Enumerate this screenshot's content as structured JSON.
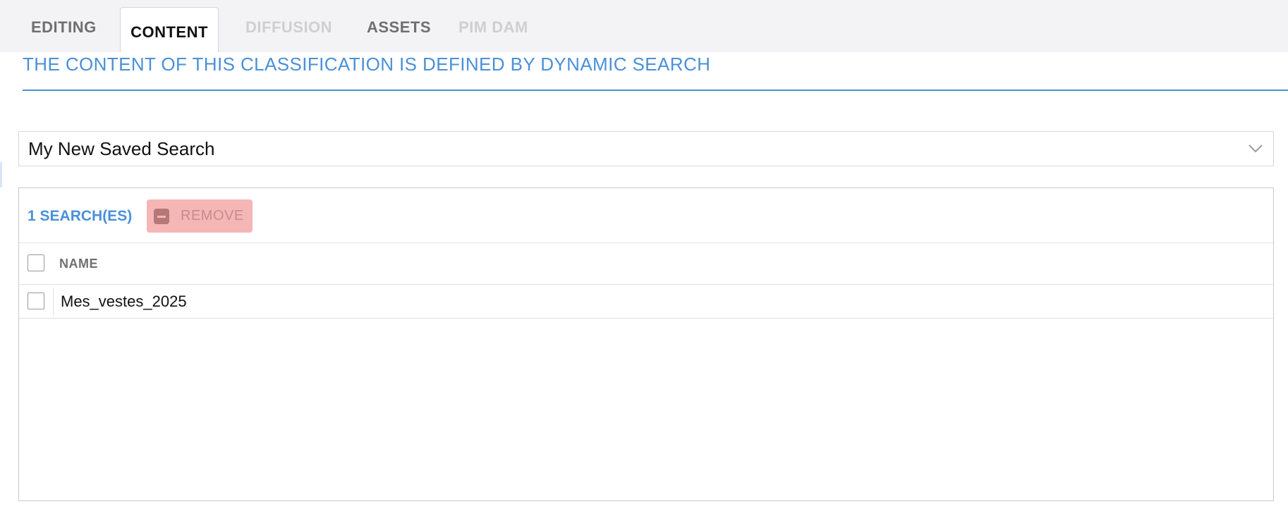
{
  "tabs": [
    {
      "label": "EDITING",
      "state": "normal"
    },
    {
      "label": "CONTENT",
      "state": "active"
    },
    {
      "label": "DIFFUSION",
      "state": "disabled"
    },
    {
      "label": "ASSETS",
      "state": "normal"
    },
    {
      "label": "PIM DAM",
      "state": "disabled"
    }
  ],
  "section": {
    "title": "THE CONTENT OF THIS CLASSIFICATION IS DEFINED BY DYNAMIC SEARCH"
  },
  "search_select": {
    "value": "My New Saved Search",
    "icon": "chevron-down-icon"
  },
  "searches_panel": {
    "count_label": "1 SEARCH(ES)",
    "remove_label": "REMOVE",
    "remove_icon": "minus-square-icon",
    "columns": [
      "NAME"
    ],
    "rows": [
      {
        "name": "Mes_vestes_2025"
      }
    ]
  },
  "colors": {
    "accent": "#4a90d9",
    "remove_bg": "#f5b6b6"
  }
}
